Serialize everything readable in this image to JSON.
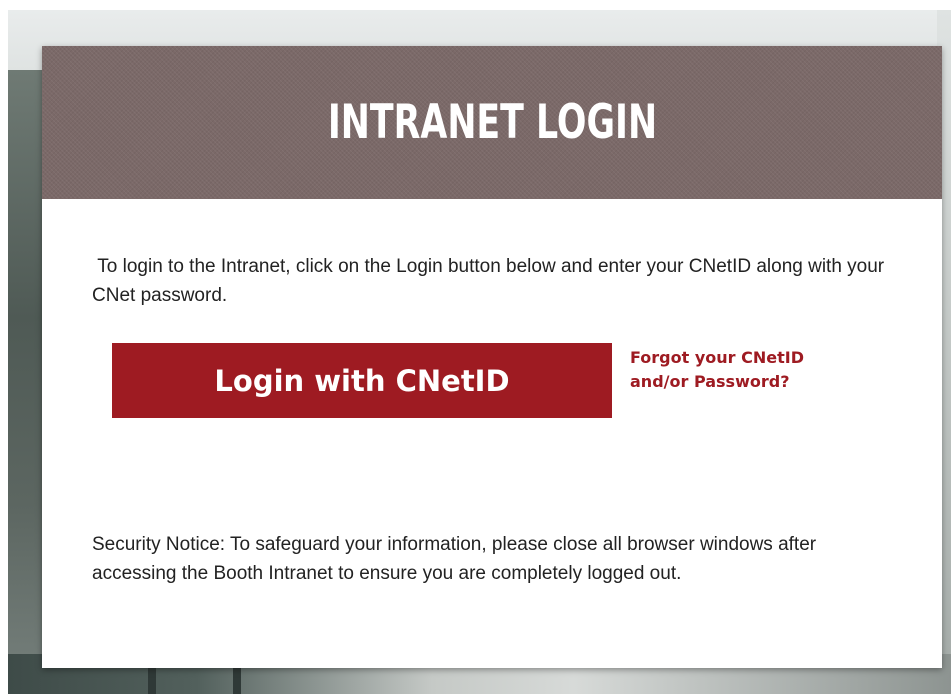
{
  "header": {
    "title": "INTRANET LOGIN"
  },
  "intro_text": " To login to the Intranet, click on the Login button below and enter your CNetID along with your CNet password.",
  "login_button_label": "Login with CNetID",
  "forgot_link_label": "Forgot your CNetID\nand/or Password?",
  "security_notice": "Security Notice: To safeguard your information, please close all browser windows after accessing the Booth Intranet to ensure you are completely logged out.",
  "colors": {
    "header_bg": "#7b6968",
    "accent": "#9e1b22",
    "text": "#222222"
  }
}
